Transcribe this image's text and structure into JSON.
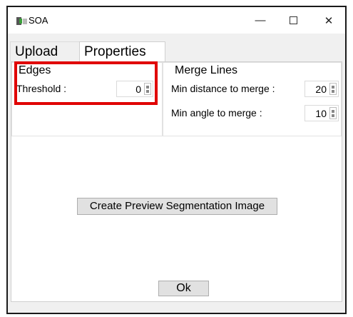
{
  "window": {
    "title": "SOA",
    "minimize_glyph": "—",
    "close_glyph": "✕"
  },
  "tabs": [
    {
      "label": "Upload",
      "active": false
    },
    {
      "label": "Properties",
      "active": true
    }
  ],
  "edges": {
    "title": "Edges",
    "threshold_label": "Threshold :",
    "threshold_value": "0"
  },
  "merge_lines": {
    "title": "Merge Lines",
    "min_distance_label": "Min distance to merge :",
    "min_distance_value": "20",
    "min_angle_label": "Min angle to merge :",
    "min_angle_value": "10"
  },
  "actions": {
    "preview_label": "Create Preview Segmentation Image",
    "ok_label": "Ok"
  },
  "colors": {
    "highlight": "#e00000",
    "panel": "#ffffff",
    "window": "#f0f0f0"
  }
}
